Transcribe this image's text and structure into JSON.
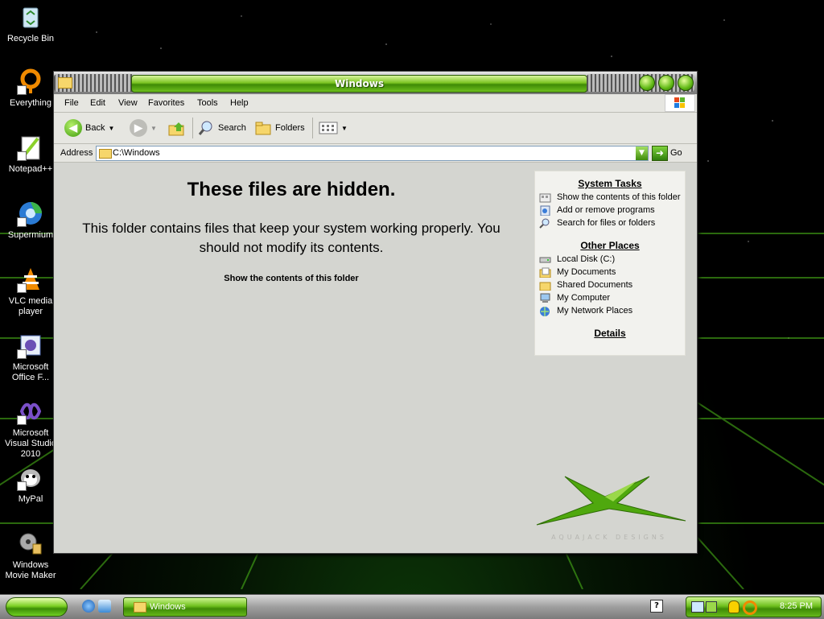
{
  "desktop": {
    "icons": [
      {
        "label": "Recycle Bin",
        "icon": "recycle-bin-icon"
      },
      {
        "label": "Everything",
        "icon": "everything-search-icon"
      },
      {
        "label": "Notepad++",
        "icon": "notepad-plus-plus-icon"
      },
      {
        "label": "Supermium",
        "icon": "supermium-browser-icon"
      },
      {
        "label": "VLC media player",
        "icon": "vlc-icon"
      },
      {
        "label": "Microsoft Office F...",
        "icon": "office-frontpage-icon"
      },
      {
        "label": "Microsoft Visual Studio 2010",
        "icon": "visual-studio-icon"
      },
      {
        "label": "MyPal",
        "icon": "mypal-browser-icon"
      },
      {
        "label": "Windows Movie Maker",
        "icon": "movie-maker-icon"
      }
    ]
  },
  "window": {
    "title": "Windows",
    "menu": [
      "File",
      "Edit",
      "View",
      "Favorites",
      "Tools",
      "Help"
    ],
    "toolbar": {
      "back_label": "Back",
      "search_label": "Search",
      "folders_label": "Folders"
    },
    "address": {
      "label": "Address",
      "value": "C:\\Windows",
      "go_label": "Go"
    },
    "content": {
      "heading": "These files are hidden.",
      "description": "This folder contains files that keep your system working properly. You should not modify its contents.",
      "show_link": "Show the contents of this folder"
    },
    "taskpane": {
      "system_tasks": {
        "title": "System Tasks",
        "items": [
          "Show the contents of this folder",
          "Add or remove programs",
          "Search for files or folders"
        ]
      },
      "other_places": {
        "title": "Other Places",
        "items": [
          "Local Disk (C:)",
          "My Documents",
          "Shared Documents",
          "My Computer",
          "My Network Places"
        ]
      },
      "details": {
        "title": "Details"
      }
    },
    "branding": "AQUAJACK DESIGNS"
  },
  "taskbar": {
    "task_label": "Windows",
    "clock": "8:25 PM"
  },
  "colors": {
    "accent_green": "#6fc01e",
    "title_bar": "#7bc421"
  }
}
